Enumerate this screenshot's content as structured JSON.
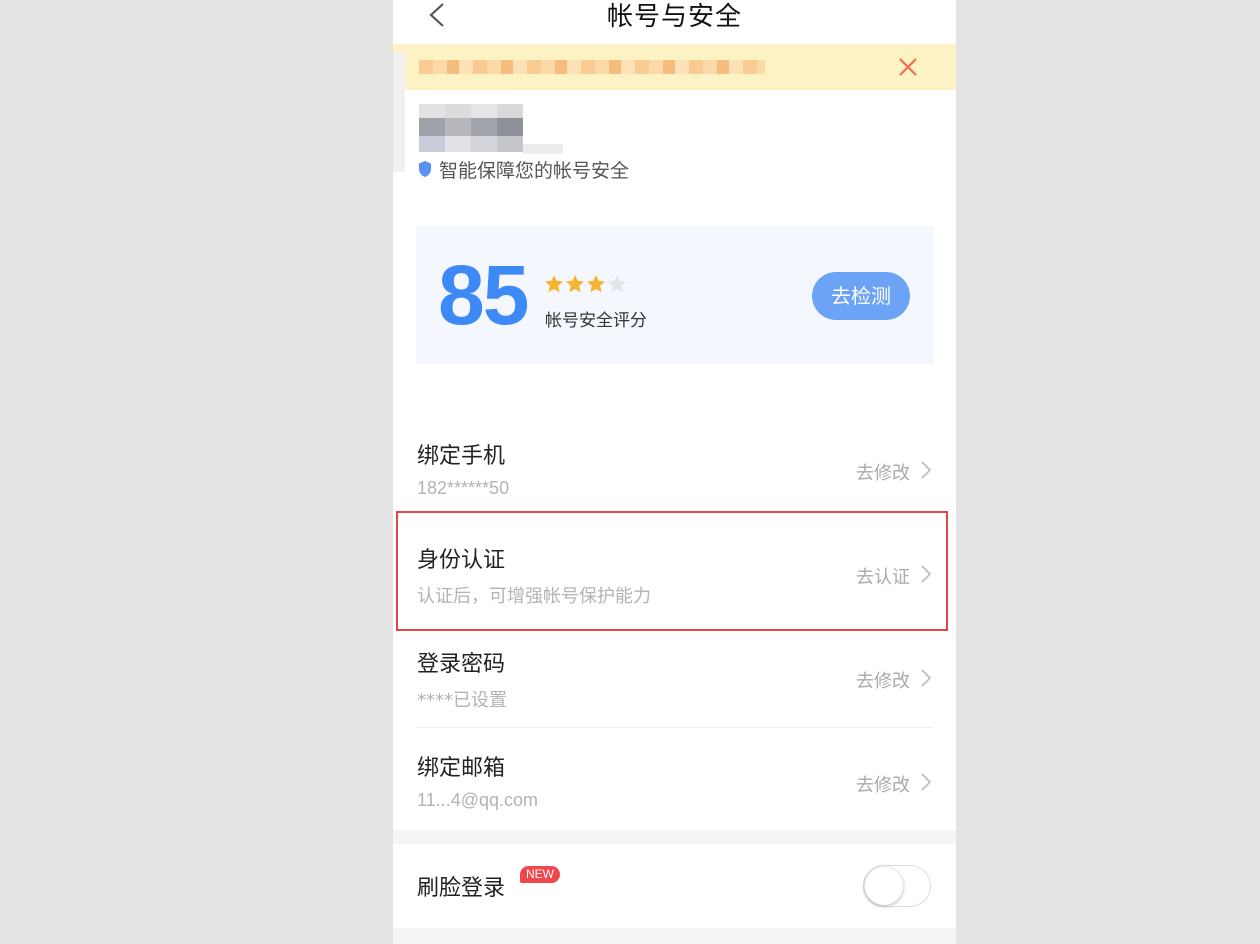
{
  "nav": {
    "title": "帐号与安全",
    "back_icon": "chevron-left-icon"
  },
  "notice": {
    "close_icon": "close-icon",
    "close_color": "#ee6b4d",
    "background": "#fdf2c4"
  },
  "header": {
    "subtitle": "智能保障您的帐号安全",
    "shield_icon": "shield-icon"
  },
  "score": {
    "value": "85",
    "rating": 3,
    "max_rating": 4,
    "label": "帐号安全评分",
    "button_label": "去检测",
    "accent_color": "#3d8af7",
    "star_color": "#f5b330"
  },
  "rows": [
    {
      "title": "绑定手机",
      "subtitle": "182******50",
      "action": "去修改"
    },
    {
      "title": "身份认证",
      "subtitle": "认证后，可增强帐号保护能力",
      "action": "去认证"
    },
    {
      "title": "登录密码",
      "subtitle": "****已设置",
      "action": "去修改"
    },
    {
      "title": "绑定邮箱",
      "subtitle": "11...4@qq.com",
      "action": "去修改"
    }
  ],
  "face_login": {
    "title": "刷脸登录",
    "badge": "NEW",
    "toggle_on": false
  }
}
